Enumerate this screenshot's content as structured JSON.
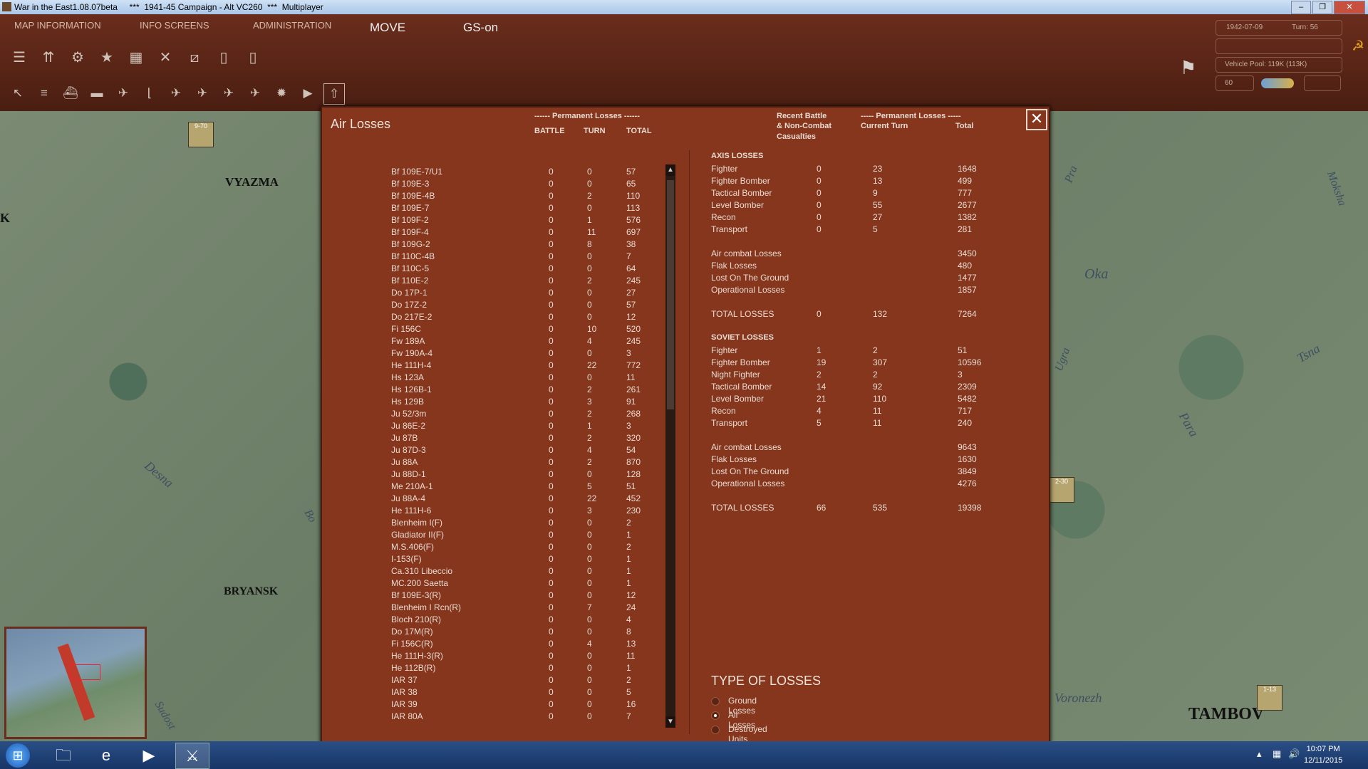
{
  "window": {
    "title": "War in the East1.08.07beta     ***  1941-45 Campaign - Alt VC260  ***  Multiplayer"
  },
  "menu": {
    "map_info": "MAP INFORMATION",
    "info_screens": "INFO SCREENS",
    "administration": "ADMINISTRATION",
    "move": "MOVE",
    "gs": "GS-on"
  },
  "status": {
    "date": "1942-07-09",
    "turn": "Turn: 56",
    "vehicle_pool": "Vehicle Pool: 119K (113K)",
    "level": "60"
  },
  "map": {
    "cities": [
      "VYAZMA",
      "BRYANSK",
      "TAMBOV"
    ],
    "edge_label": "K",
    "rivers": [
      "Oka",
      "Tsna",
      "Para",
      "Voronezh",
      "Desna",
      "Moksha",
      "Pra",
      "Ugra",
      "Bo",
      "Sudost"
    ],
    "units": [
      "9-70",
      "2-30",
      "1-13"
    ]
  },
  "dialog": {
    "title": "Air Losses",
    "left_header": {
      "group": "------ Permanent Losses ------",
      "battle": "BATTLE",
      "turn": "TURN",
      "total": "TOTAL"
    },
    "right_header": {
      "recent": "Recent Battle",
      "noncombat": "& Non-Combat",
      "casualties": "Casualties",
      "group": "----- Permanent Losses -----",
      "current_turn": "Current Turn",
      "total": "Total"
    },
    "aircraft": [
      {
        "name": "Bf 109E-7/U1",
        "battle": "0",
        "turn": "0",
        "total": "57"
      },
      {
        "name": "Bf 109E-3",
        "battle": "0",
        "turn": "0",
        "total": "65"
      },
      {
        "name": "Bf 109E-4B",
        "battle": "0",
        "turn": "2",
        "total": "110"
      },
      {
        "name": "Bf 109E-7",
        "battle": "0",
        "turn": "0",
        "total": "113"
      },
      {
        "name": "Bf 109F-2",
        "battle": "0",
        "turn": "1",
        "total": "576"
      },
      {
        "name": "Bf 109F-4",
        "battle": "0",
        "turn": "11",
        "total": "697"
      },
      {
        "name": "Bf 109G-2",
        "battle": "0",
        "turn": "8",
        "total": "38"
      },
      {
        "name": "Bf 110C-4B",
        "battle": "0",
        "turn": "0",
        "total": "7"
      },
      {
        "name": "Bf 110C-5",
        "battle": "0",
        "turn": "0",
        "total": "64"
      },
      {
        "name": "Bf 110E-2",
        "battle": "0",
        "turn": "2",
        "total": "245"
      },
      {
        "name": "Do 17P-1",
        "battle": "0",
        "turn": "0",
        "total": "27"
      },
      {
        "name": "Do 17Z-2",
        "battle": "0",
        "turn": "0",
        "total": "57"
      },
      {
        "name": "Do 217E-2",
        "battle": "0",
        "turn": "0",
        "total": "12"
      },
      {
        "name": "Fi 156C",
        "battle": "0",
        "turn": "10",
        "total": "520"
      },
      {
        "name": "Fw 189A",
        "battle": "0",
        "turn": "4",
        "total": "245"
      },
      {
        "name": "Fw 190A-4",
        "battle": "0",
        "turn": "0",
        "total": "3"
      },
      {
        "name": "He 111H-4",
        "battle": "0",
        "turn": "22",
        "total": "772"
      },
      {
        "name": "Hs 123A",
        "battle": "0",
        "turn": "0",
        "total": "11"
      },
      {
        "name": "Hs 126B-1",
        "battle": "0",
        "turn": "2",
        "total": "261"
      },
      {
        "name": "Hs 129B",
        "battle": "0",
        "turn": "3",
        "total": "91"
      },
      {
        "name": "Ju 52/3m",
        "battle": "0",
        "turn": "2",
        "total": "268"
      },
      {
        "name": "Ju 86E-2",
        "battle": "0",
        "turn": "1",
        "total": "3"
      },
      {
        "name": "Ju 87B",
        "battle": "0",
        "turn": "2",
        "total": "320"
      },
      {
        "name": "Ju 87D-3",
        "battle": "0",
        "turn": "4",
        "total": "54"
      },
      {
        "name": "Ju 88A",
        "battle": "0",
        "turn": "2",
        "total": "870"
      },
      {
        "name": "Ju 88D-1",
        "battle": "0",
        "turn": "0",
        "total": "128"
      },
      {
        "name": "Me 210A-1",
        "battle": "0",
        "turn": "5",
        "total": "51"
      },
      {
        "name": "Ju 88A-4",
        "battle": "0",
        "turn": "22",
        "total": "452"
      },
      {
        "name": "He 111H-6",
        "battle": "0",
        "turn": "3",
        "total": "230"
      },
      {
        "name": "Blenheim I(F)",
        "battle": "0",
        "turn": "0",
        "total": "2"
      },
      {
        "name": "Gladiator II(F)",
        "battle": "0",
        "turn": "0",
        "total": "1"
      },
      {
        "name": "M.S.406(F)",
        "battle": "0",
        "turn": "0",
        "total": "2"
      },
      {
        "name": "I-153(F)",
        "battle": "0",
        "turn": "0",
        "total": "1"
      },
      {
        "name": "Ca.310 Libeccio",
        "battle": "0",
        "turn": "0",
        "total": "1"
      },
      {
        "name": "MC.200 Saetta",
        "battle": "0",
        "turn": "0",
        "total": "1"
      },
      {
        "name": "Bf 109E-3(R)",
        "battle": "0",
        "turn": "0",
        "total": "12"
      },
      {
        "name": "Blenheim I Rcn(R)",
        "battle": "0",
        "turn": "7",
        "total": "24"
      },
      {
        "name": "Bloch 210(R)",
        "battle": "0",
        "turn": "0",
        "total": "4"
      },
      {
        "name": "Do 17M(R)",
        "battle": "0",
        "turn": "0",
        "total": "8"
      },
      {
        "name": "Fi 156C(R)",
        "battle": "0",
        "turn": "4",
        "total": "13"
      },
      {
        "name": "He 111H-3(R)",
        "battle": "0",
        "turn": "0",
        "total": "11"
      },
      {
        "name": "He 112B(R)",
        "battle": "0",
        "turn": "0",
        "total": "1"
      },
      {
        "name": "IAR 37",
        "battle": "0",
        "turn": "0",
        "total": "2"
      },
      {
        "name": "IAR 38",
        "battle": "0",
        "turn": "0",
        "total": "5"
      },
      {
        "name": "IAR 39",
        "battle": "0",
        "turn": "0",
        "total": "16"
      },
      {
        "name": "IAR 80A",
        "battle": "0",
        "turn": "0",
        "total": "7"
      }
    ],
    "axis": {
      "heading": "AXIS LOSSES",
      "types": [
        {
          "label": "Fighter",
          "battle": "0",
          "turn": "23",
          "total": "1648"
        },
        {
          "label": "Fighter Bomber",
          "battle": "0",
          "turn": "13",
          "total": "499"
        },
        {
          "label": "Tactical Bomber",
          "battle": "0",
          "turn": "9",
          "total": "777"
        },
        {
          "label": "Level Bomber",
          "battle": "0",
          "turn": "55",
          "total": "2677"
        },
        {
          "label": "Recon",
          "battle": "0",
          "turn": "27",
          "total": "1382"
        },
        {
          "label": "Transport",
          "battle": "0",
          "turn": "5",
          "total": "281"
        }
      ],
      "categories": [
        {
          "label": "Air combat Losses",
          "total": "3450"
        },
        {
          "label": "Flak Losses",
          "total": "480"
        },
        {
          "label": "Lost On The Ground",
          "total": "1477"
        },
        {
          "label": "Operational Losses",
          "total": "1857"
        }
      ],
      "totals": {
        "label": "TOTAL LOSSES",
        "battle": "0",
        "turn": "132",
        "total": "7264"
      }
    },
    "soviet": {
      "heading": "SOVIET LOSSES",
      "types": [
        {
          "label": "Fighter",
          "battle": "1",
          "turn": "2",
          "total": "51"
        },
        {
          "label": "Fighter Bomber",
          "battle": "19",
          "turn": "307",
          "total": "10596"
        },
        {
          "label": "Night Fighter",
          "battle": "2",
          "turn": "2",
          "total": "3"
        },
        {
          "label": "Tactical Bomber",
          "battle": "14",
          "turn": "92",
          "total": "2309"
        },
        {
          "label": "Level Bomber",
          "battle": "21",
          "turn": "110",
          "total": "5482"
        },
        {
          "label": "Recon",
          "battle": "4",
          "turn": "11",
          "total": "717"
        },
        {
          "label": "Transport",
          "battle": "5",
          "turn": "11",
          "total": "240"
        }
      ],
      "categories": [
        {
          "label": "Air combat Losses",
          "total": "9643"
        },
        {
          "label": "Flak Losses",
          "total": "1630"
        },
        {
          "label": "Lost On The Ground",
          "total": "3849"
        },
        {
          "label": "Operational Losses",
          "total": "4276"
        }
      ],
      "totals": {
        "label": "TOTAL LOSSES",
        "battle": "66",
        "turn": "535",
        "total": "19398"
      }
    },
    "type_of_losses": {
      "title": "TYPE OF LOSSES",
      "options": [
        {
          "label": "Ground Losses",
          "selected": false
        },
        {
          "label": "Air Losses",
          "selected": true
        },
        {
          "label": "Destroyed Units",
          "selected": false
        }
      ]
    }
  },
  "taskbar": {
    "time": "10:07 PM",
    "date": "12/11/2015"
  }
}
